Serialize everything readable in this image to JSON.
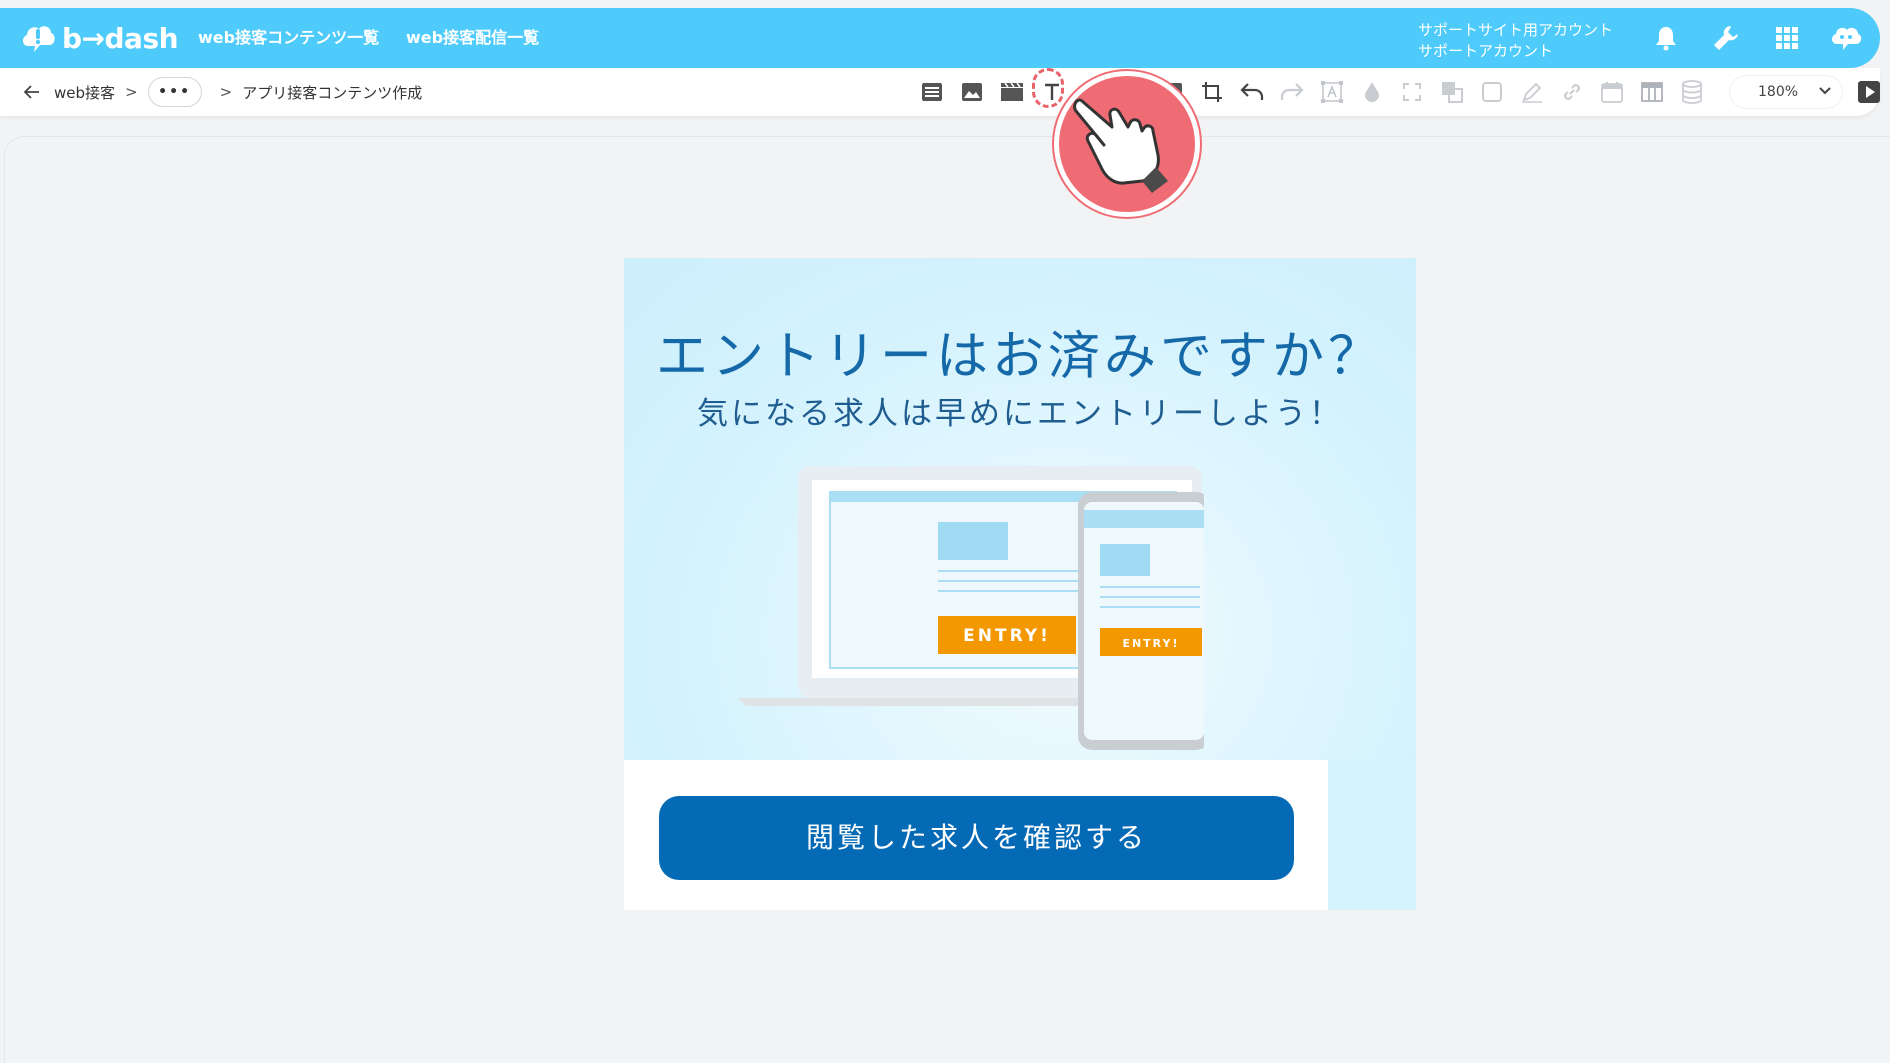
{
  "header": {
    "logo_text": "b→dash",
    "nav": [
      "web接客コンテンツ一覧",
      "web接客配信一覧"
    ],
    "account_line1": "サポートサイト用アカウント",
    "account_line2": "サポートアカウント",
    "icons": [
      "bell-icon",
      "wrench-icon",
      "grid-apps-icon",
      "support-chat-icon"
    ]
  },
  "breadcrumb": {
    "back_icon": "arrow-left-icon",
    "root": "web接客",
    "separator": ">",
    "more": "•••",
    "current": "アプリ接客コンテンツ作成"
  },
  "toolbar": {
    "tools": [
      "list-icon",
      "image-icon",
      "video-icon",
      "text-icon",
      "shape-icon",
      "crop-icon",
      "undo-icon",
      "redo-icon",
      "text-frame-icon",
      "color-drop-icon",
      "resize-icon",
      "layer-icon",
      "border-icon",
      "pen-icon",
      "link-icon",
      "calendar-icon",
      "table-icon",
      "database-icon"
    ],
    "zoom_value": "180%",
    "play_icon": "play-icon"
  },
  "banner": {
    "headline": "エントリーはお済みですか？",
    "subline": "気になる求人は早めにエントリーしよう！",
    "illustration_entry_laptop": "ENTRY!",
    "illustration_entry_phone": "ENTRY!",
    "cta_label": "閲覧した求人を確認する"
  },
  "colors": {
    "header_bg": "#4ecbfa",
    "banner_bg": "#d6f3fd",
    "headline": "#1669a8",
    "cta_bg": "#056ab6",
    "entry_orange": "#f39800",
    "pointer": "#f06c74"
  }
}
